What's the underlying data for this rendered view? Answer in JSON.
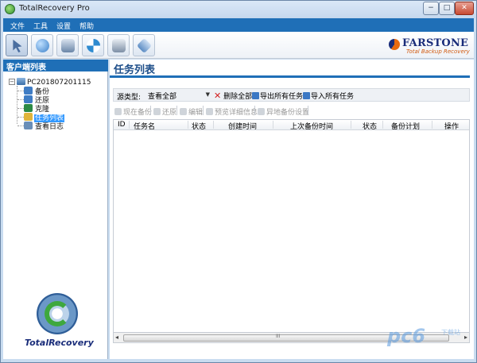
{
  "window": {
    "title": "TotalRecovery Pro",
    "min": "−",
    "max": "□",
    "close": "✕"
  },
  "menu": [
    "文件",
    "工具",
    "设置",
    "帮助"
  ],
  "toolbar": {
    "buttons": [
      {
        "icon": "pointer-icon",
        "color": "#4a6ea0"
      },
      {
        "icon": "globe-network-icon",
        "color": "#3a7fc8"
      },
      {
        "icon": "backup-drive-icon",
        "color": "#6a86a8"
      },
      {
        "icon": "lifebuoy-restore-icon",
        "color": "#2e8bd0"
      },
      {
        "icon": "search-disk-icon",
        "color": "#7d8fa6"
      },
      {
        "icon": "settings-diamond-icon",
        "color": "#5b8cc4"
      }
    ],
    "selected_index": 0
  },
  "brand": {
    "name": "FARSTONE",
    "tagline": "Total Backup Recovery"
  },
  "left_panel": {
    "header": "客户端列表",
    "tree": {
      "expander": "−",
      "root": "PC201807201115",
      "children": [
        {
          "label": "备份",
          "icon": "backup-icon",
          "color": "#3f7cc4"
        },
        {
          "label": "还原",
          "icon": "restore-icon",
          "color": "#3f7cc4"
        },
        {
          "label": "克隆",
          "icon": "clone-icon",
          "color": "#2c8a45"
        },
        {
          "label": "任务列表",
          "icon": "folder-tasks-icon",
          "color": "#e0b43a",
          "selected": true
        },
        {
          "label": "查看日志",
          "icon": "log-icon",
          "color": "#6a8fb8"
        }
      ]
    },
    "product_logo": "TotalRecovery"
  },
  "main": {
    "title": "任务列表",
    "filter": {
      "label": "源类型:",
      "value": "查看全部",
      "delete_all": "删除全部",
      "export_all": "导出所有任务",
      "import_all": "导入所有任务"
    },
    "actions": [
      "现在备份",
      "还原",
      "编辑",
      "预览详细信息",
      "异地备份设置"
    ],
    "table": {
      "columns": [
        "ID",
        "任务名",
        "状态",
        "创建时间",
        "上次备份时间",
        "状态",
        "备份计划",
        "操作"
      ],
      "rows": []
    },
    "scrollbar": {
      "grip": "III",
      "left": "◂",
      "right": "▸"
    }
  },
  "watermark": {
    "logo": "pc6",
    "sub": "下载站"
  }
}
